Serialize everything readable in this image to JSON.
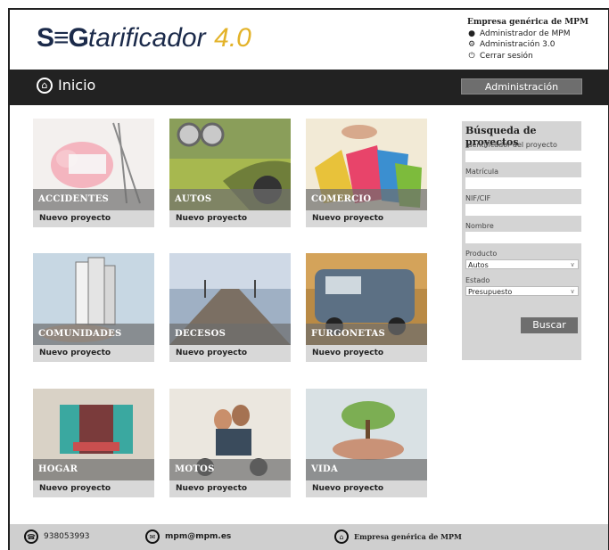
{
  "logo": {
    "brand_a": "S",
    "brand_eq": "≡",
    "brand_b": "G",
    "product": "tarificador",
    "version": "4.0"
  },
  "user": {
    "company": "Empresa genérica de MPM",
    "name": "Administrador de MPM",
    "admin_link": "Administración 3.0",
    "logout": "Cerrar sesión"
  },
  "nav": {
    "home": "Inicio",
    "admin_button": "Administración"
  },
  "tiles": [
    {
      "title": "ACCIDENTES",
      "action": "Nuevo proyecto"
    },
    {
      "title": "AUTOS",
      "action": "Nuevo proyecto"
    },
    {
      "title": "COMERCIO",
      "action": "Nuevo proyecto"
    },
    {
      "title": "COMUNIDADES",
      "action": "Nuevo proyecto"
    },
    {
      "title": "DECESOS",
      "action": "Nuevo proyecto"
    },
    {
      "title": "FURGONETAS",
      "action": "Nuevo proyecto"
    },
    {
      "title": "HOGAR",
      "action": "Nuevo proyecto"
    },
    {
      "title": "MOTOS",
      "action": "Nuevo proyecto"
    },
    {
      "title": "VIDA",
      "action": "Nuevo proyecto"
    }
  ],
  "search": {
    "title": "Búsqueda de proyectos",
    "id_label": "Identificador del proyecto",
    "plate_label": "Matrícula",
    "nif_label": "NIF/CIF",
    "name_label": "Nombre",
    "product_label": "Producto",
    "product_value": "Autos",
    "status_label": "Estado",
    "status_value": "Presupuesto",
    "button": "Buscar"
  },
  "footer": {
    "phone": "938053993",
    "email": "mpm@mpm.es",
    "company": "Empresa genérica de MPM"
  }
}
